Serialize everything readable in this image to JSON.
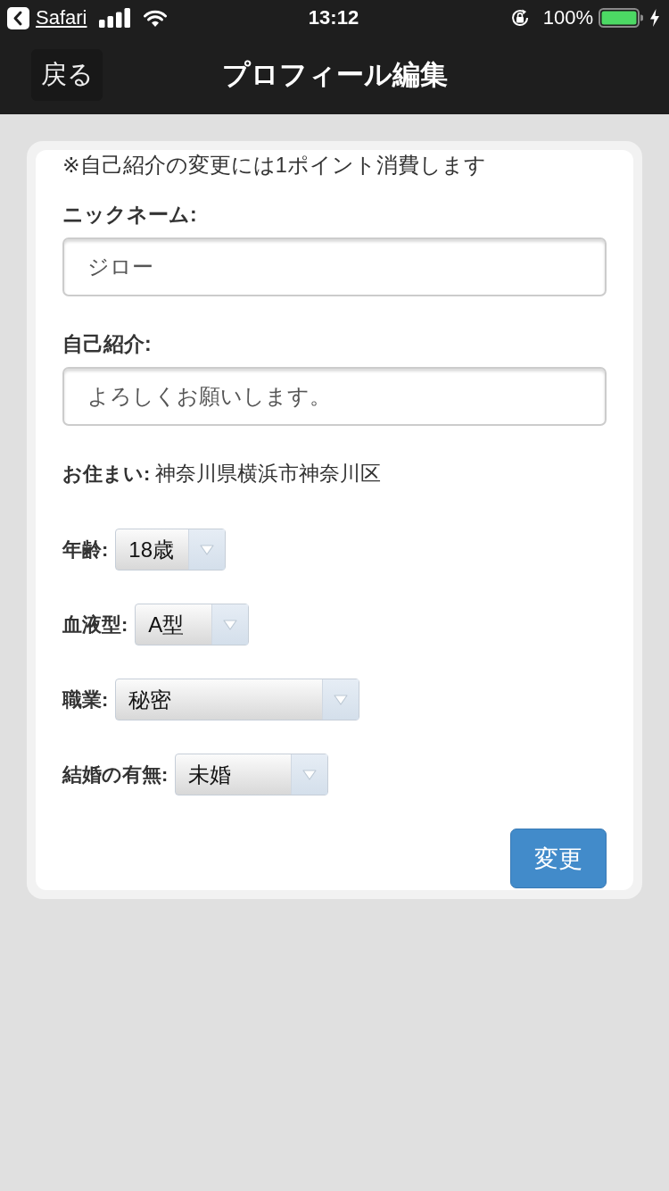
{
  "status_bar": {
    "back_app": "Safari",
    "time": "13:12",
    "battery": "100%"
  },
  "nav_bar": {
    "back_button": "戻る",
    "title": "プロフィール編集"
  },
  "form": {
    "notice": "※自己紹介の変更には1ポイント消費します",
    "text_fields": [
      {
        "label": "ニックネーム:",
        "value": "ジロー"
      },
      {
        "label": "自己紹介:",
        "value": "よろしくお願いします。"
      }
    ],
    "residence": {
      "label": "お住まい:",
      "value": "神奈川県横浜市神奈川区"
    },
    "selects": [
      {
        "label": "年齢:",
        "value": "18歳"
      },
      {
        "label": "血液型:",
        "value": "A型"
      },
      {
        "label": "職業:",
        "value": "秘密"
      },
      {
        "label": "結婚の有無:",
        "value": "未婚"
      }
    ],
    "submit_button": "変更"
  }
}
